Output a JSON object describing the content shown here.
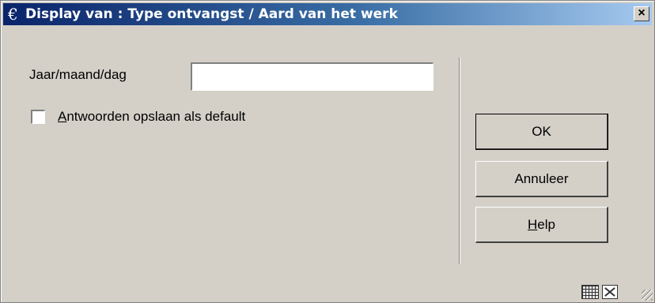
{
  "window": {
    "icon_glyph": "€",
    "title": "Display van : Type ontvangst / Aard van het werk",
    "close_label": "×"
  },
  "form": {
    "date_label": "Jaar/maand/dag",
    "date_value": "",
    "date_placeholder": "",
    "checkbox_checked": false,
    "checkbox_label_mnemonic": "A",
    "checkbox_label_rest": "ntwoorden opslaan als default"
  },
  "buttons": {
    "ok_label": "OK",
    "cancel_label": "Annuleer",
    "help_mnemonic": "H",
    "help_rest": "elp"
  },
  "statusbar": {
    "icons": [
      "calendar-grid-icon",
      "maximize-icon",
      "resize-grip-icon"
    ]
  },
  "colors": {
    "titlebar_start": "#0a246a",
    "titlebar_end": "#a6caf0",
    "dialog_bg": "#d4d0c8"
  }
}
